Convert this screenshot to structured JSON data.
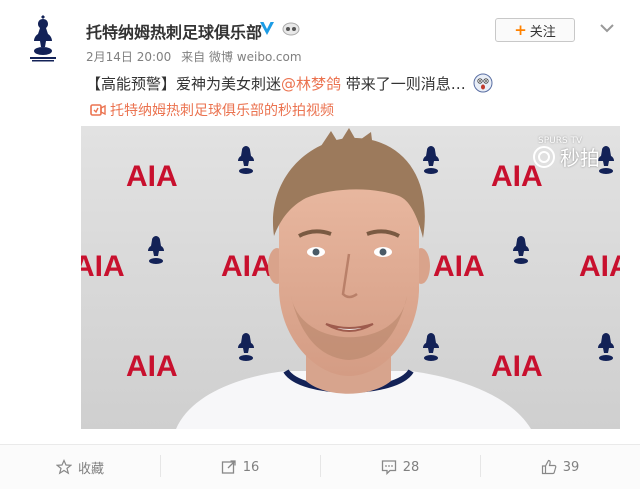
{
  "post": {
    "author": "托特纳姆热刺足球俱乐部",
    "date": "2月14日 20:00",
    "source_prefix": "来自",
    "source": "微博 weibo.com",
    "follow_label": "关注",
    "text_prefix": "【高能预警】爱神为美女刺迷",
    "mention": "@林梦鸽",
    "text_suffix": " 带来了一则消息…",
    "video_link": "托特纳姆热刺足球俱乐部的秒拍视频"
  },
  "video": {
    "sponsor": "AIA",
    "watermark_top": "SPURS TV",
    "watermark": "秒拍"
  },
  "actions": {
    "favorite": "收藏",
    "repost_count": "16",
    "comment_count": "28",
    "like_count": "39"
  },
  "colors": {
    "accent": "#eb7350",
    "follow_plus": "#ff8200",
    "verified": "#1d9ce5",
    "sponsor_red": "#c8102e",
    "spurs_navy": "#132257"
  }
}
